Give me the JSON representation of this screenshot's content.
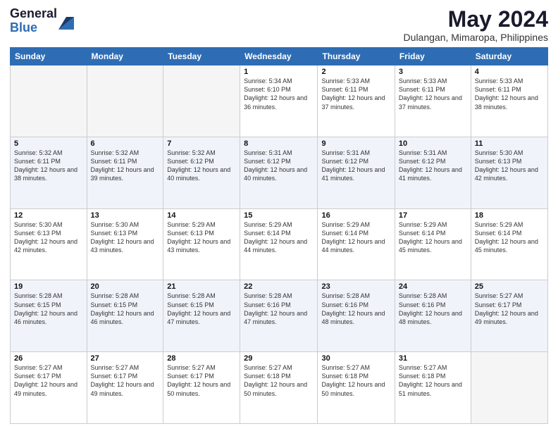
{
  "logo": {
    "general": "General",
    "blue": "Blue"
  },
  "title": "May 2024",
  "location": "Dulangan, Mimaropa, Philippines",
  "days_of_week": [
    "Sunday",
    "Monday",
    "Tuesday",
    "Wednesday",
    "Thursday",
    "Friday",
    "Saturday"
  ],
  "weeks": [
    [
      {
        "day": "",
        "info": ""
      },
      {
        "day": "",
        "info": ""
      },
      {
        "day": "",
        "info": ""
      },
      {
        "day": "1",
        "info": "Sunrise: 5:34 AM\nSunset: 6:10 PM\nDaylight: 12 hours\nand 36 minutes."
      },
      {
        "day": "2",
        "info": "Sunrise: 5:33 AM\nSunset: 6:11 PM\nDaylight: 12 hours\nand 37 minutes."
      },
      {
        "day": "3",
        "info": "Sunrise: 5:33 AM\nSunset: 6:11 PM\nDaylight: 12 hours\nand 37 minutes."
      },
      {
        "day": "4",
        "info": "Sunrise: 5:33 AM\nSunset: 6:11 PM\nDaylight: 12 hours\nand 38 minutes."
      }
    ],
    [
      {
        "day": "5",
        "info": "Sunrise: 5:32 AM\nSunset: 6:11 PM\nDaylight: 12 hours\nand 38 minutes."
      },
      {
        "day": "6",
        "info": "Sunrise: 5:32 AM\nSunset: 6:11 PM\nDaylight: 12 hours\nand 39 minutes."
      },
      {
        "day": "7",
        "info": "Sunrise: 5:32 AM\nSunset: 6:12 PM\nDaylight: 12 hours\nand 40 minutes."
      },
      {
        "day": "8",
        "info": "Sunrise: 5:31 AM\nSunset: 6:12 PM\nDaylight: 12 hours\nand 40 minutes."
      },
      {
        "day": "9",
        "info": "Sunrise: 5:31 AM\nSunset: 6:12 PM\nDaylight: 12 hours\nand 41 minutes."
      },
      {
        "day": "10",
        "info": "Sunrise: 5:31 AM\nSunset: 6:12 PM\nDaylight: 12 hours\nand 41 minutes."
      },
      {
        "day": "11",
        "info": "Sunrise: 5:30 AM\nSunset: 6:13 PM\nDaylight: 12 hours\nand 42 minutes."
      }
    ],
    [
      {
        "day": "12",
        "info": "Sunrise: 5:30 AM\nSunset: 6:13 PM\nDaylight: 12 hours\nand 42 minutes."
      },
      {
        "day": "13",
        "info": "Sunrise: 5:30 AM\nSunset: 6:13 PM\nDaylight: 12 hours\nand 43 minutes."
      },
      {
        "day": "14",
        "info": "Sunrise: 5:29 AM\nSunset: 6:13 PM\nDaylight: 12 hours\nand 43 minutes."
      },
      {
        "day": "15",
        "info": "Sunrise: 5:29 AM\nSunset: 6:14 PM\nDaylight: 12 hours\nand 44 minutes."
      },
      {
        "day": "16",
        "info": "Sunrise: 5:29 AM\nSunset: 6:14 PM\nDaylight: 12 hours\nand 44 minutes."
      },
      {
        "day": "17",
        "info": "Sunrise: 5:29 AM\nSunset: 6:14 PM\nDaylight: 12 hours\nand 45 minutes."
      },
      {
        "day": "18",
        "info": "Sunrise: 5:29 AM\nSunset: 6:14 PM\nDaylight: 12 hours\nand 45 minutes."
      }
    ],
    [
      {
        "day": "19",
        "info": "Sunrise: 5:28 AM\nSunset: 6:15 PM\nDaylight: 12 hours\nand 46 minutes."
      },
      {
        "day": "20",
        "info": "Sunrise: 5:28 AM\nSunset: 6:15 PM\nDaylight: 12 hours\nand 46 minutes."
      },
      {
        "day": "21",
        "info": "Sunrise: 5:28 AM\nSunset: 6:15 PM\nDaylight: 12 hours\nand 47 minutes."
      },
      {
        "day": "22",
        "info": "Sunrise: 5:28 AM\nSunset: 6:16 PM\nDaylight: 12 hours\nand 47 minutes."
      },
      {
        "day": "23",
        "info": "Sunrise: 5:28 AM\nSunset: 6:16 PM\nDaylight: 12 hours\nand 48 minutes."
      },
      {
        "day": "24",
        "info": "Sunrise: 5:28 AM\nSunset: 6:16 PM\nDaylight: 12 hours\nand 48 minutes."
      },
      {
        "day": "25",
        "info": "Sunrise: 5:27 AM\nSunset: 6:17 PM\nDaylight: 12 hours\nand 49 minutes."
      }
    ],
    [
      {
        "day": "26",
        "info": "Sunrise: 5:27 AM\nSunset: 6:17 PM\nDaylight: 12 hours\nand 49 minutes."
      },
      {
        "day": "27",
        "info": "Sunrise: 5:27 AM\nSunset: 6:17 PM\nDaylight: 12 hours\nand 49 minutes."
      },
      {
        "day": "28",
        "info": "Sunrise: 5:27 AM\nSunset: 6:17 PM\nDaylight: 12 hours\nand 50 minutes."
      },
      {
        "day": "29",
        "info": "Sunrise: 5:27 AM\nSunset: 6:18 PM\nDaylight: 12 hours\nand 50 minutes."
      },
      {
        "day": "30",
        "info": "Sunrise: 5:27 AM\nSunset: 6:18 PM\nDaylight: 12 hours\nand 50 minutes."
      },
      {
        "day": "31",
        "info": "Sunrise: 5:27 AM\nSunset: 6:18 PM\nDaylight: 12 hours\nand 51 minutes."
      },
      {
        "day": "",
        "info": ""
      }
    ]
  ]
}
